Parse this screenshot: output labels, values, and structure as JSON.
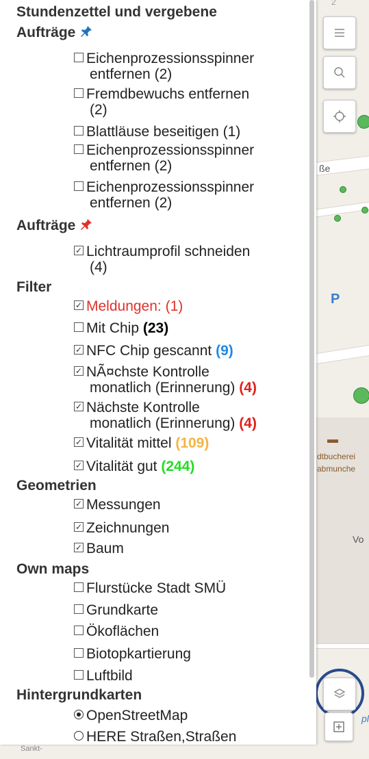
{
  "panel": {
    "sections": {
      "stundenzettel": "Stundenzettel und vergebene",
      "auftraege1": "Aufträge",
      "auftraege2": "Aufträge",
      "filter": "Filter",
      "geometrien": "Geometrien",
      "ownmaps": "Own maps",
      "hintergrund": "Hintergrundkarten"
    },
    "stundenzettel_items": [
      {
        "label": "Eichenprozessionsspinner",
        "label2": "entfernen (2)",
        "checked": false
      },
      {
        "label": "Fremdbewuchs entfernen",
        "label2": "(2)",
        "checked": false
      },
      {
        "label": "Blattläuse beseitigen (1)",
        "checked": false
      },
      {
        "label": "Eichenprozessionsspinner",
        "label2": "entfernen (2)",
        "checked": false
      },
      {
        "label": "Eichenprozessionsspinner",
        "label2": "entfernen (2)",
        "checked": false
      }
    ],
    "auftraege_items": [
      {
        "label": "Lichtraumprofil schneiden",
        "label2": "(4)",
        "checked": true
      }
    ],
    "filter_items": [
      {
        "label": "Meldungen: (1)",
        "checked": true,
        "color": "#e0302a"
      },
      {
        "label": "Mit Chip ",
        "count": "(23)",
        "count_color": "#000000",
        "checked": false
      },
      {
        "label": "NFC Chip gescannt ",
        "count": "(9)",
        "count_color": "#1e88e5",
        "checked": true
      },
      {
        "label": "NÃ¤chste Kontrolle",
        "label2": "monatlich (Erinnerung) ",
        "count": "(4)",
        "count_color": "#e0201a",
        "checked": true
      },
      {
        "label": "Nächste Kontrolle",
        "label2": "monatlich (Erinnerung) ",
        "count": "(4)",
        "count_color": "#e0201a",
        "checked": true
      },
      {
        "label": "Vitalität mittel ",
        "count": "(109)",
        "count_color": "#f5b342",
        "checked": true
      },
      {
        "label": "Vitalität gut ",
        "count": "(244)",
        "count_color": "#22dd22",
        "checked": true
      }
    ],
    "geometrien_items": [
      {
        "label": "Messungen",
        "checked": true
      },
      {
        "label": "Zeichnungen",
        "checked": true
      },
      {
        "label": "Baum",
        "checked": true
      }
    ],
    "ownmaps_items": [
      {
        "label": "Flurstücke Stadt SMÜ",
        "checked": false
      },
      {
        "label": "Grundkarte",
        "checked": false
      },
      {
        "label": "Ökoflächen",
        "checked": false
      },
      {
        "label": "Biotopkartierung",
        "checked": false
      },
      {
        "label": "Luftbild",
        "checked": false
      }
    ],
    "hintergrund_items": [
      {
        "label": "OpenStreetMap",
        "checked": true
      },
      {
        "label": "HERE Straßen,Straßen",
        "checked": false
      }
    ]
  },
  "map": {
    "labels": {
      "strasse": "ße",
      "parking": "P",
      "library1": "dtbucherei",
      "library2": "abmunche",
      "vo": "Vo",
      "sankt": "Sankt-",
      "bottom_right": "pl",
      "top_num": "2"
    }
  },
  "icons": [
    "menu-icon",
    "search-icon",
    "locate-icon",
    "layers-icon",
    "add-icon",
    "pin-icon"
  ],
  "colors": {
    "pin_blue": "#1e73be",
    "pin_red": "#e0302a",
    "highlight_circle": "#2a4a8e",
    "dot_green": "#5cb85c"
  }
}
